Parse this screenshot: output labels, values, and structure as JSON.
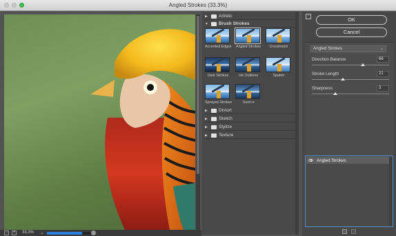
{
  "window": {
    "title": "Angled Strokes (33.3%)"
  },
  "statusbar": {
    "zoom_out": "−",
    "zoom_in": "+",
    "zoom": "33.3%",
    "zoom_chevron": "⌄",
    "progress": 0.78
  },
  "gallery": {
    "folders_top": [
      {
        "label": "Artistic",
        "expanded": false
      },
      {
        "label": "Brush Strokes",
        "expanded": true
      }
    ],
    "thumbnails": [
      {
        "label": "Accented Edges",
        "selected": false
      },
      {
        "label": "Angled Strokes",
        "selected": true
      },
      {
        "label": "Crosshatch",
        "selected": false
      },
      {
        "label": "Dark Strokes",
        "selected": false
      },
      {
        "label": "Ink Outlines",
        "selected": false
      },
      {
        "label": "Spatter",
        "selected": false
      },
      {
        "label": "Sprayed Strokes",
        "selected": false
      },
      {
        "label": "Sumi-e",
        "selected": false
      }
    ],
    "folders_bottom": [
      {
        "label": "Distort"
      },
      {
        "label": "Sketch"
      },
      {
        "label": "Stylize"
      },
      {
        "label": "Texture"
      }
    ],
    "tri_collapsed": "▶",
    "tri_expanded": "▼"
  },
  "right": {
    "ok": "OK",
    "cancel": "Cancel",
    "collapse": "⌃",
    "filter_select": "Angled Strokes",
    "filter_chevron": "⌄",
    "params": [
      {
        "label": "Direction Balance",
        "value": "66",
        "fraction": 0.66
      },
      {
        "label": "Stroke Length",
        "value": "21",
        "fraction": 0.4
      },
      {
        "label": "Sharpness",
        "value": "3",
        "fraction": 0.3
      }
    ],
    "layer": {
      "label": "Angled Strokes"
    }
  },
  "icons": {
    "eye": "eye-icon",
    "new_layer": "new-layer-icon",
    "trash": "trash-icon",
    "folder": "folder-icon"
  },
  "colors": {
    "accent": "#2e7fe0",
    "ok_border": "#c9c9c9"
  }
}
